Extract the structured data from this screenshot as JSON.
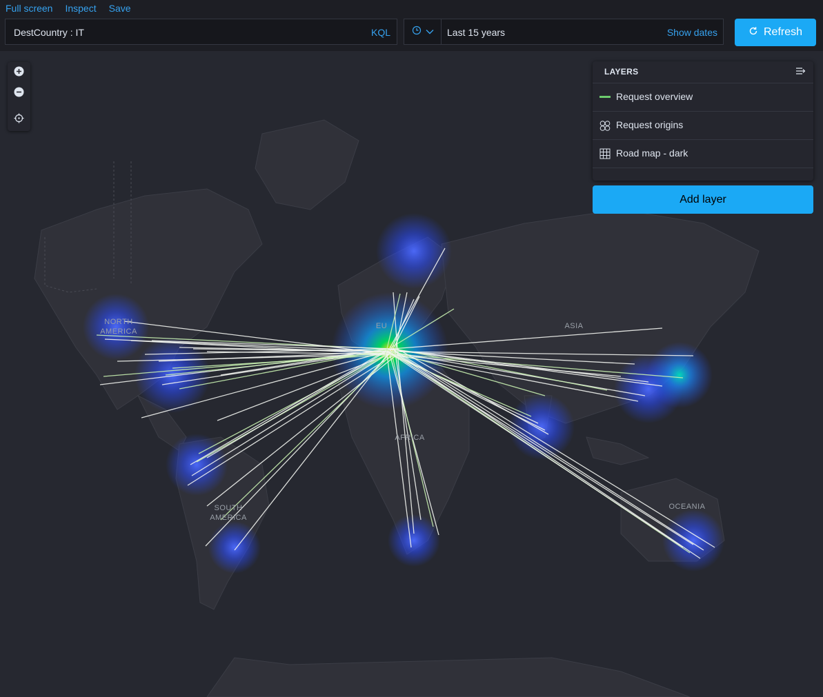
{
  "topnav": {
    "full_screen": "Full screen",
    "inspect": "Inspect",
    "save": "Save"
  },
  "query": {
    "value": "DestCountry : IT",
    "language": "KQL"
  },
  "date_picker": {
    "range": "Last 15 years",
    "show_dates": "Show dates"
  },
  "refresh": {
    "label": "Refresh"
  },
  "layers": {
    "title": "LAYERS",
    "items": [
      {
        "label": "Request overview",
        "icon": "line-layer-icon"
      },
      {
        "label": "Request origins",
        "icon": "cluster-layer-icon"
      },
      {
        "label": "Road map - dark",
        "icon": "grid-layer-icon"
      }
    ],
    "add_label": "Add layer"
  },
  "map_labels": {
    "north_america": [
      "NORTH",
      "AMERICA"
    ],
    "south_america": [
      "SOUTH",
      "AMERICA"
    ],
    "asia": "ASIA",
    "africa": "AFRICA",
    "oceania": "OCEANIA",
    "europe": "EU"
  },
  "colors": {
    "accent": "#1ba9f5",
    "link": "#36a2ef",
    "map_bg": "#262830",
    "land": "#303139",
    "heat_core": "#00c853",
    "heat_glow": "#2b5cff"
  }
}
